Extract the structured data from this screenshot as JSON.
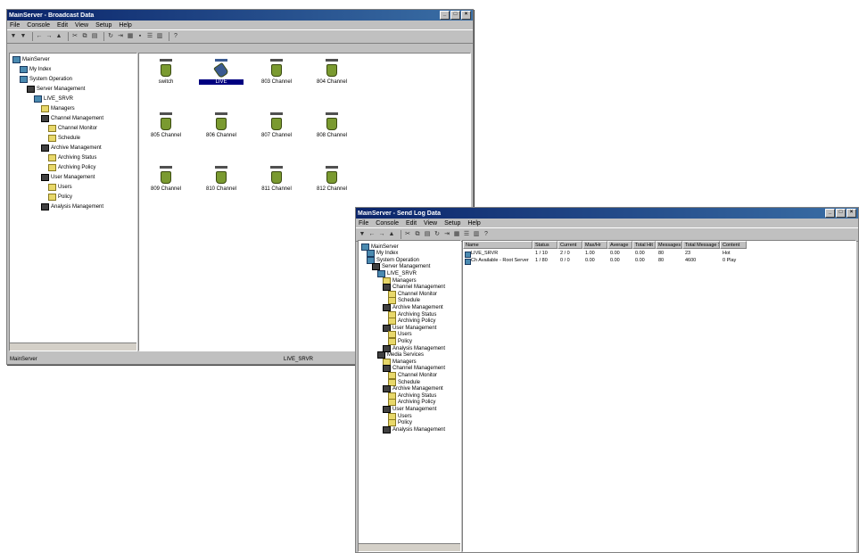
{
  "window1": {
    "title": "MainServer - Broadcast Data",
    "menu": [
      "File",
      "Console",
      "Edit",
      "View",
      "Setup",
      "Help"
    ],
    "tree": [
      {
        "label": "MainServer",
        "icon": "server",
        "level": 0
      },
      {
        "label": "My Index",
        "icon": "computer",
        "level": 1
      },
      {
        "label": "System Operation",
        "icon": "computer",
        "level": 1
      },
      {
        "label": "Server Management",
        "icon": "dark",
        "level": 2
      },
      {
        "label": "LIVE_SRVR",
        "icon": "computer",
        "level": 3
      },
      {
        "label": "Managers",
        "icon": "folder",
        "level": 4
      },
      {
        "label": "Channel Management",
        "icon": "dark",
        "level": 4
      },
      {
        "label": "Channel Monitor",
        "icon": "folder",
        "level": 5
      },
      {
        "label": "Schedule",
        "icon": "folder",
        "level": 5
      },
      {
        "label": "Archive Management",
        "icon": "dark",
        "level": 4
      },
      {
        "label": "Archiving Status",
        "icon": "folder",
        "level": 5
      },
      {
        "label": "Archiving Policy",
        "icon": "folder",
        "level": 5
      },
      {
        "label": "User Management",
        "icon": "dark",
        "level": 4
      },
      {
        "label": "Users",
        "icon": "folder",
        "level": 5
      },
      {
        "label": "Policy",
        "icon": "folder",
        "level": 5
      },
      {
        "label": "Analysis Management",
        "icon": "dark",
        "level": 4
      }
    ],
    "channels": [
      "switch",
      "LIVE",
      "803 Channel",
      "804 Channel",
      "805 Channel",
      "806 Channel",
      "807 Channel",
      "808 Channel",
      "809 Channel",
      "810 Channel",
      "811 Channel",
      "812 Channel"
    ],
    "status_left": "MainServer",
    "status_right": "LIVE_SRVR"
  },
  "window2": {
    "title": "MainServer - Send Log Data",
    "menu": [
      "File",
      "Console",
      "Edit",
      "View",
      "Setup",
      "Help"
    ],
    "tree": [
      {
        "label": "MainServer",
        "icon": "server",
        "level": 0
      },
      {
        "label": "My Index",
        "icon": "computer",
        "level": 1
      },
      {
        "label": "System Operation",
        "icon": "computer",
        "level": 1
      },
      {
        "label": "Server Management",
        "icon": "dark",
        "level": 2
      },
      {
        "label": "LIVE_SRVR",
        "icon": "computer",
        "level": 3
      },
      {
        "label": "Managers",
        "icon": "folder",
        "level": 4
      },
      {
        "label": "Channel Management",
        "icon": "dark",
        "level": 4
      },
      {
        "label": "Channel Monitor",
        "icon": "folder",
        "level": 5
      },
      {
        "label": "Schedule",
        "icon": "folder",
        "level": 5
      },
      {
        "label": "Archive Management",
        "icon": "dark",
        "level": 4
      },
      {
        "label": "Archiving Status",
        "icon": "folder",
        "level": 5
      },
      {
        "label": "Archiving Policy",
        "icon": "folder",
        "level": 5
      },
      {
        "label": "User Management",
        "icon": "dark",
        "level": 4
      },
      {
        "label": "Users",
        "icon": "folder",
        "level": 5
      },
      {
        "label": "Policy",
        "icon": "folder",
        "level": 5
      },
      {
        "label": "Analysis Management",
        "icon": "dark",
        "level": 4
      },
      {
        "label": "Media Services",
        "icon": "dark",
        "level": 3
      },
      {
        "label": "Managers",
        "icon": "folder",
        "level": 4
      },
      {
        "label": "Channel Management",
        "icon": "dark",
        "level": 4
      },
      {
        "label": "Channel Monitor",
        "icon": "folder",
        "level": 5
      },
      {
        "label": "Schedule",
        "icon": "folder",
        "level": 5
      },
      {
        "label": "Archive Management",
        "icon": "dark",
        "level": 4
      },
      {
        "label": "Archiving Status",
        "icon": "folder",
        "level": 5
      },
      {
        "label": "Archiving Policy",
        "icon": "folder",
        "level": 5
      },
      {
        "label": "User Management",
        "icon": "dark",
        "level": 4
      },
      {
        "label": "Users",
        "icon": "folder",
        "level": 5
      },
      {
        "label": "Policy",
        "icon": "folder",
        "level": 5
      },
      {
        "label": "Analysis Management",
        "icon": "dark",
        "level": 4
      }
    ],
    "columns": [
      "Name",
      "Status",
      "Current",
      "Max/Hr",
      "Average",
      "Total Hit",
      "Messages",
      "Total Message Size",
      "Content"
    ],
    "rows": [
      [
        "LIVE_SRVR",
        "1 / 10",
        "2 / 0",
        "1.00",
        "0.00",
        "0.00",
        "80",
        "23",
        "Hot"
      ],
      [
        "Ch Available - Root Server",
        "1 / 80",
        "0 / 0",
        "0.00",
        "0.00",
        "0.00",
        "80",
        "4600",
        "0 Play"
      ]
    ]
  }
}
